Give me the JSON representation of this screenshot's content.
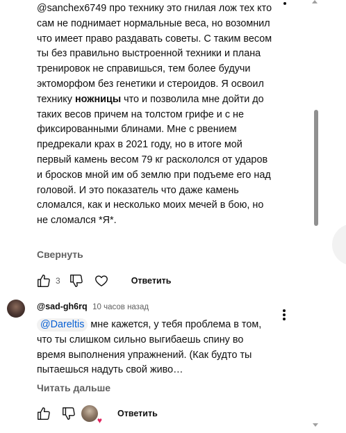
{
  "comment1": {
    "text_before_bold": "@sanchex6749 про технику это гнилая лож тех кто сам не поднимает нормальные веса, но возомнил что имеет право раздавать советы. С таким весом ты без правильно выстроенной техники и плана тренировок не справишься, тем более будучи эктоморфом без генетики и стероидов. Я освоил технику ",
    "bold_word": "ножницы",
    "text_after_bold": " что и позволила мне дойти до таких весов причем на толстом грифе и с не фиксированными блинами. Мне с рвением предрекали крах в 2021 году, но в итоге мой первый камень весом 79 кг раскололся от ударов и бросков мной им об землю при подъеме его над головой. И это показатель что даже камень сломался, как и несколько моих мечей в бою, но не сломался *Я*.",
    "collapse_label": "Свернуть",
    "like_count": "3",
    "reply_label": "Ответить"
  },
  "comment2": {
    "author": "@sad-gh6rq",
    "time": "10 часов назад",
    "mention": "@Dareltis",
    "text": " мне кажется, у тебя проблема в том, что ты слишком сильно выгибаешь спину во время выполнения упражнений. (Как будто ты пытаешься надуть свой живо…",
    "read_more_label": "Читать дальше",
    "reply_label": "Ответить",
    "creator_heart": "♥"
  },
  "icons": {
    "like": "thumbs-up-icon",
    "dislike": "thumbs-down-icon",
    "heart": "heart-outline-icon",
    "menu": "kebab-menu-icon"
  },
  "colors": {
    "text": "#0f0f0f",
    "secondary": "#606060",
    "link": "#065fd4",
    "heart": "#e0245e"
  }
}
